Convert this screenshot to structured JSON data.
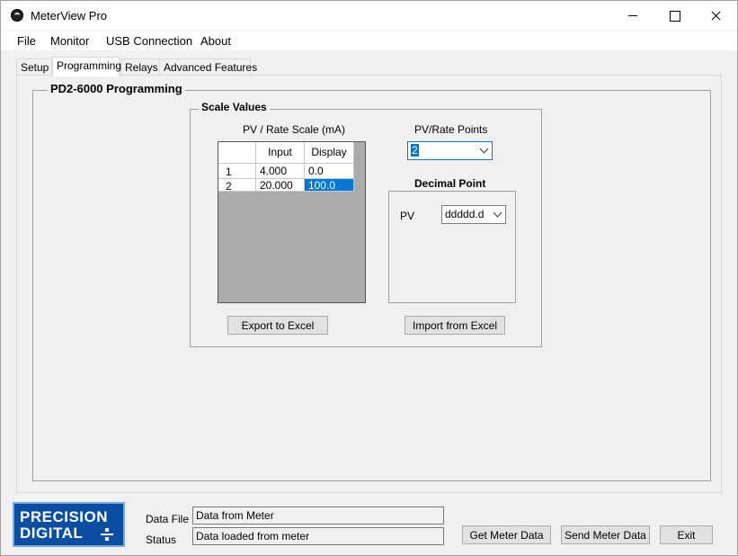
{
  "window": {
    "title": "MeterView Pro"
  },
  "menu": [
    "File",
    "Monitor",
    "USB Connection",
    "About"
  ],
  "tabs": [
    "Setup",
    "Programming",
    "Relays",
    "Advanced Features"
  ],
  "programming": {
    "title": "PD2-6000 Programming",
    "scale_values": {
      "title": "Scale Values",
      "grid_title": "PV / Rate Scale (mA)",
      "columns": [
        "Input",
        "Display"
      ],
      "rows": [
        {
          "index": "1",
          "input": "4.000",
          "display": "0.0"
        },
        {
          "index": "2",
          "input": "20.000",
          "display": "100.0"
        }
      ],
      "points_label": "PV/Rate Points",
      "points_value": "2",
      "decimal_point": {
        "title": "Decimal Point",
        "pv_label": "PV",
        "pv_value": "ddddd.d"
      },
      "export_button": "Export to Excel",
      "import_button": "Import from Excel"
    }
  },
  "footer": {
    "logo": {
      "line1": "PRECISION",
      "line2": "DIGITAL"
    },
    "data_file_label": "Data File",
    "data_file_value": "Data from Meter",
    "status_label": "Status",
    "status_value": "Data loaded from meter",
    "get_button": "Get Meter Data",
    "send_button": "Send Meter Data",
    "exit_button": "Exit"
  },
  "colors": {
    "selection": "#0078d7",
    "logo_blue": "#0a4ea2"
  }
}
